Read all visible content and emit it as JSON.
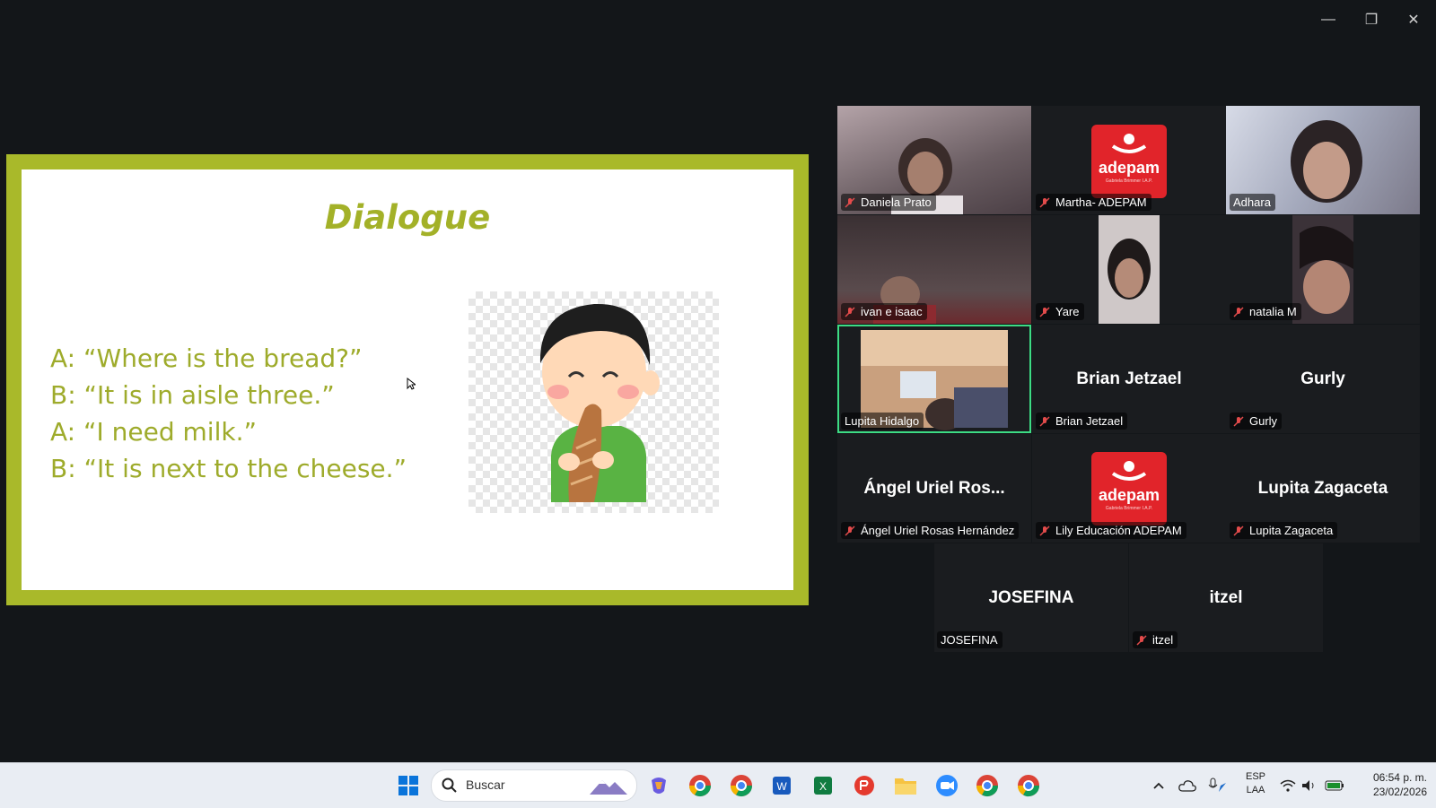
{
  "window_controls": {
    "minimize": "—",
    "restore": "❐",
    "close": "✕"
  },
  "slide": {
    "title": "Dialogue",
    "lines": [
      "A: “Where is the bread?”",
      "B: “It is in aisle three.”",
      "A: “I need milk.”",
      "B: “It is next to the cheese.”"
    ]
  },
  "adepam_logo": {
    "word": "adepam",
    "sub": "Gabriela Brimmer I.A.P."
  },
  "participants": [
    {
      "name": "Daniela Prato",
      "muted": true
    },
    {
      "name": "Martha- ADEPAM",
      "muted": true
    },
    {
      "name": "Adhara",
      "muted": false
    },
    {
      "name": "ivan e isaac",
      "muted": true
    },
    {
      "name": "Yare",
      "muted": true
    },
    {
      "name": "natalia M",
      "muted": true
    },
    {
      "name": "Lupita Hidalgo",
      "muted": false
    },
    {
      "name": "Brian Jetzael",
      "muted": true,
      "display": "Brian Jetzael"
    },
    {
      "name": "Gurly",
      "muted": true,
      "display": "Gurly"
    },
    {
      "name": "Ángel Uriel Rosas Hernández",
      "muted": true,
      "display": "Ángel Uriel Ros..."
    },
    {
      "name": "Lily Educación ADEPAM",
      "muted": true
    },
    {
      "name": "Lupita Zagaceta",
      "muted": true,
      "display": "Lupita Zagaceta"
    },
    {
      "name": "JOSEFINA",
      "muted": false,
      "display": "JOSEFINA"
    },
    {
      "name": "itzel",
      "muted": true,
      "display": "itzel"
    }
  ],
  "taskbar": {
    "search_placeholder": "Buscar",
    "lang_top": "ESP",
    "lang_bottom": "LAA",
    "time": "06:54 p. m.",
    "date": "23/02/2026"
  },
  "colors": {
    "slide_border": "#a9b92a",
    "slide_text": "#9eab2b",
    "active_speaker": "#3ddc84",
    "adepam_red": "#e1242a"
  }
}
